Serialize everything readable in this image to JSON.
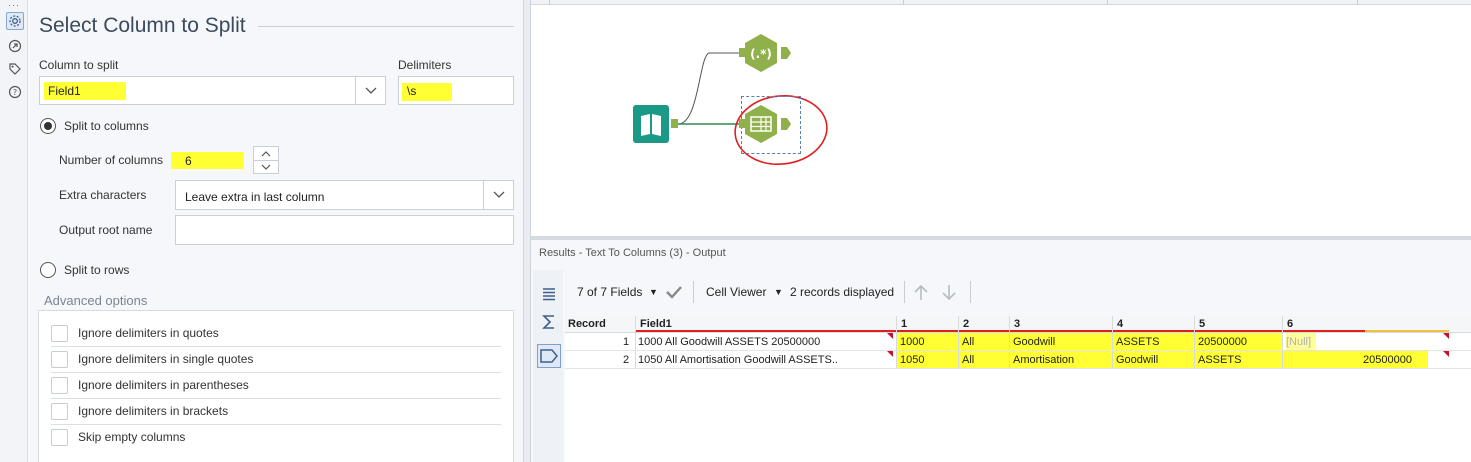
{
  "config": {
    "title": "Select Column to Split",
    "column_label": "Column to split",
    "column_value": "Field1",
    "delimiters_label": "Delimiters",
    "delimiters_value": "\\s",
    "split_columns_label": "Split to columns",
    "num_columns_label": "Number of columns",
    "num_columns_value": "6",
    "extra_chars_label": "Extra characters",
    "extra_chars_value": "Leave extra in last column",
    "output_root_label": "Output root name",
    "output_root_value": "",
    "split_rows_label": "Split to rows",
    "advanced_label": "Advanced options",
    "advanced": [
      "Ignore delimiters in quotes",
      "Ignore delimiters in single quotes",
      "Ignore delimiters in parentheses",
      "Ignore delimiters in brackets",
      "Skip empty columns"
    ],
    "selected_mode": "columns"
  },
  "canvas": {
    "tools": [
      {
        "name": "Input Data",
        "icon": "book-icon",
        "color": "#1a9a86"
      },
      {
        "name": "RegEx",
        "icon": "regex-icon",
        "glyph": "(.*)",
        "color": "#8fb04a"
      },
      {
        "name": "Text To Columns",
        "icon": "text-to-columns-icon",
        "color": "#8fb04a"
      }
    ]
  },
  "results": {
    "title": "Results - Text To Columns (3) - Output",
    "fields_label": "7 of 7 Fields",
    "viewer_label": "Cell Viewer",
    "records_label": "2 records displayed",
    "headers": [
      "Record",
      "Field1",
      "1",
      "2",
      "3",
      "4",
      "5",
      "6"
    ],
    "rows": [
      [
        "1",
        "1000 All Goodwill ASSETS 20500000",
        "1000",
        "All",
        "Goodwill",
        "ASSETS",
        "20500000",
        "[Null]"
      ],
      [
        "2",
        "1050 All Amortisation Goodwill ASSETS..",
        "1050",
        "All",
        "Amortisation",
        "Goodwill",
        "ASSETS",
        "20500000"
      ]
    ]
  },
  "colors": {
    "highlight": "#ffff33",
    "annotation": "#e02020",
    "tool_green": "#8fb04a",
    "input_teal": "#1a9a86"
  }
}
